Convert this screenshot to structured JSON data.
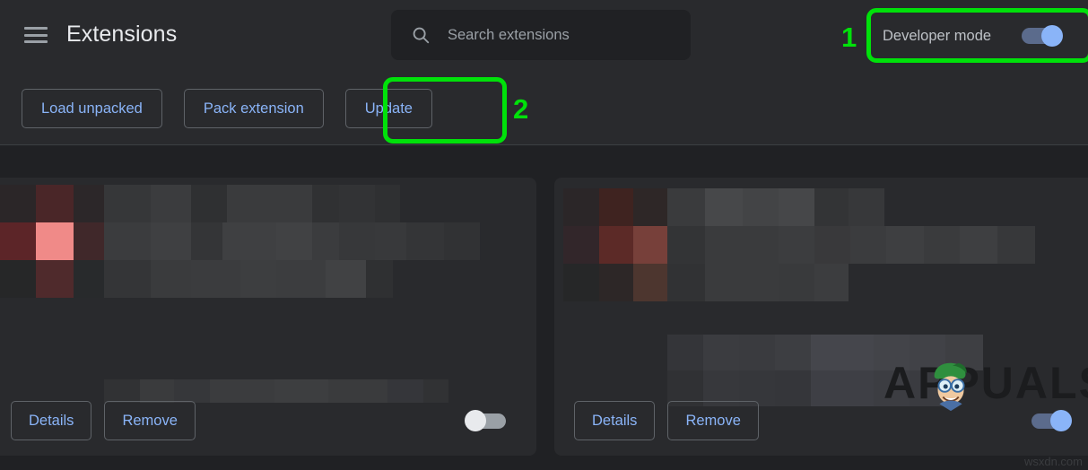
{
  "header": {
    "menu_icon": "hamburger-menu-icon",
    "title": "Extensions",
    "search": {
      "icon": "search-icon",
      "placeholder": "Search extensions",
      "value": ""
    },
    "developer_mode": {
      "label": "Developer mode",
      "state": "on",
      "toggle_icon": "toggle-switch-on"
    }
  },
  "toolbar": {
    "load_unpacked_label": "Load unpacked",
    "pack_extension_label": "Pack extension",
    "update_label": "Update"
  },
  "cards": [
    {
      "name": "extension-card-left",
      "details_label": "Details",
      "remove_label": "Remove",
      "enabled": false,
      "toggle_icon": "toggle-switch-off",
      "content": "blurred"
    },
    {
      "name": "extension-card-right",
      "details_label": "Details",
      "remove_label": "Remove",
      "enabled": true,
      "toggle_icon": "toggle-switch-on",
      "content": "blurred"
    }
  ],
  "annotations": [
    {
      "number": "1",
      "target": "developer-mode-toggle"
    },
    {
      "number": "2",
      "target": "update-button"
    }
  ],
  "watermark": {
    "text": "APPUALS",
    "mascot_icon": "appuals-mascot-icon"
  },
  "site_credit": "wsxdn.com",
  "colors": {
    "page_bg": "#202124",
    "surface": "#292a2d",
    "accent_link": "#8ab4f8",
    "text_primary": "#e8eaed",
    "text_secondary": "#bdc1c6",
    "annotation_green": "#00e10a",
    "toggle_on_knob": "#8ab4f8",
    "toggle_off_knob": "#e8eaed"
  }
}
